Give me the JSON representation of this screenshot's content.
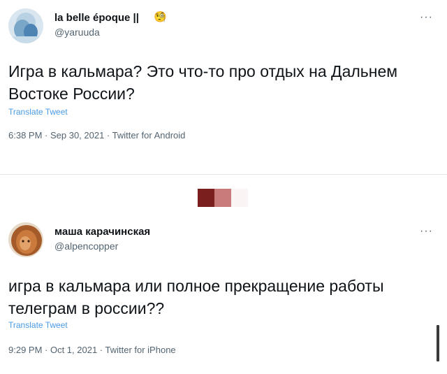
{
  "tweets": [
    {
      "display_name": "la belle époque ||",
      "emoji": "🧐",
      "handle": "@yaruuda",
      "text_line1": "Игра в кальмара? Это что-то про отдых на Дальнем",
      "text_line2": "Востоке России?",
      "translate": "Translate Tweet",
      "meta": "6:38 PM · Sep 30, 2021 · Twitter for Android",
      "more": "···"
    },
    {
      "display_name": "маша карачинская",
      "handle": "@alpencopper",
      "text_line1": "игра в кальмара или полное прекращение работы",
      "text_line2": "телеграм в россии??",
      "translate": "Translate Tweet",
      "meta": "9:29 PM · Oct 1, 2021 · Twitter for iPhone",
      "more": "···"
    }
  ],
  "colors": {
    "link": "#4a9be4",
    "muted": "#536471",
    "divider_dark": "#7a1e1e",
    "divider_light": "#c97a7a"
  }
}
